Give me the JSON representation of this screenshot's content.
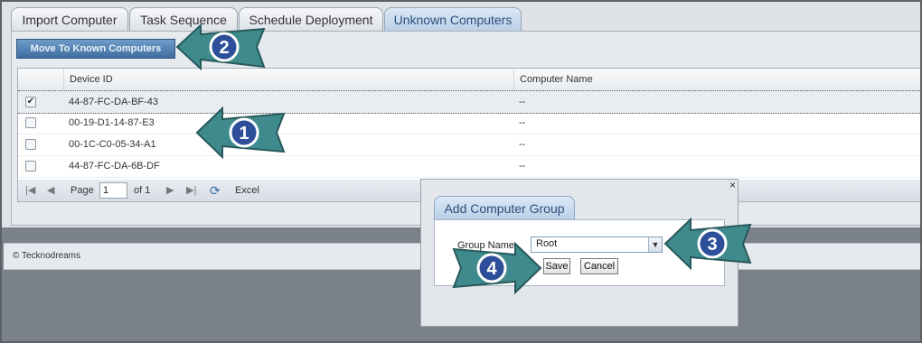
{
  "tabs": [
    {
      "label": "Import Computer"
    },
    {
      "label": "Task Sequence"
    },
    {
      "label": "Schedule Deployment"
    },
    {
      "label": "Unknown Computers"
    }
  ],
  "toolbar": {
    "move_label": "Move To Known Computers"
  },
  "grid": {
    "columns": [
      "Device ID",
      "Computer Name"
    ],
    "rows": [
      {
        "checked": true,
        "device_id": "44-87-FC-DA-BF-43",
        "name": "--"
      },
      {
        "checked": false,
        "device_id": "00-19-D1-14-87-E3",
        "name": "--"
      },
      {
        "checked": false,
        "device_id": "00-1C-C0-05-34-A1",
        "name": "--"
      },
      {
        "checked": false,
        "device_id": "44-87-FC-DA-6B-DF",
        "name": "--"
      }
    ]
  },
  "pager": {
    "page_label": "Page",
    "page_value": "1",
    "of_label": "of 1",
    "export_label": "Excel"
  },
  "footer": {
    "copyright": "© Tecknodreams"
  },
  "dialog": {
    "close_glyph": "×",
    "title": "Add Computer Group",
    "group_label": "Group Name",
    "group_value": "Root",
    "save_label": "Save",
    "cancel_label": "Cancel"
  },
  "callouts": [
    "1",
    "2",
    "3",
    "4"
  ],
  "icons": {
    "checkmark": "✔",
    "first_page": "|◀",
    "prev_page": "◀",
    "next_page": "▶",
    "last_page": "▶|",
    "refresh": "⟳",
    "dropdown": "▼"
  },
  "colors": {
    "callout_arrow": "#3f8a8c",
    "callout_badge": "#2d4f9a",
    "accent_tab": "#c5d8ec"
  }
}
